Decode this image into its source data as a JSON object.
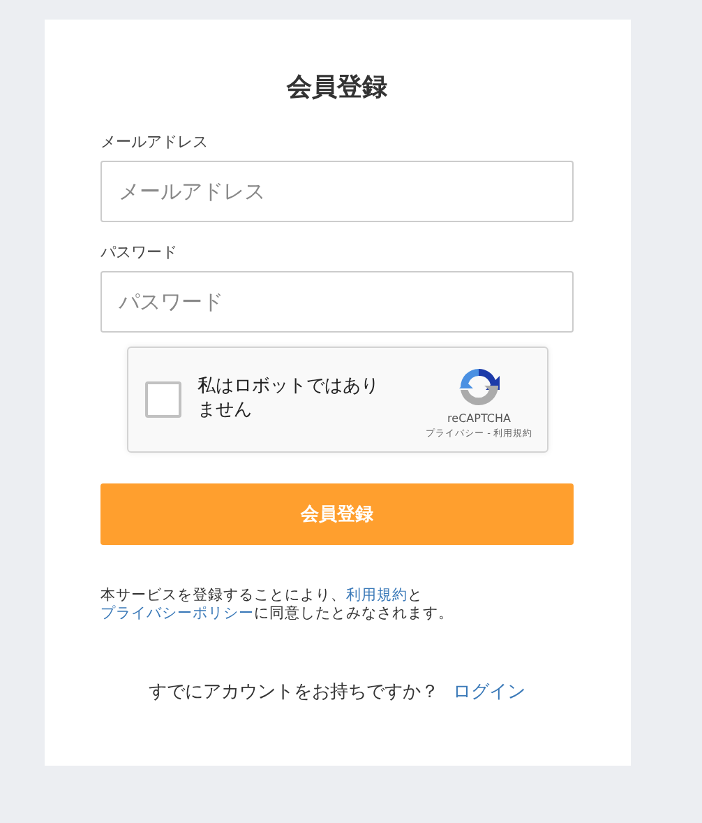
{
  "title": "会員登録",
  "fields": [
    {
      "label": "メールアドレス",
      "placeholder": "メールアドレス"
    },
    {
      "label": "パスワード",
      "placeholder": "パスワード"
    }
  ],
  "captcha": {
    "checked": false,
    "text": "私はロボットではありません",
    "brand": "reCAPTCHA",
    "links": "プライバシー - 利用規約"
  },
  "submit": "会員登録",
  "terms": {
    "before": "本サービスを登録することにより、",
    "link1": "利用規約",
    "middle": "と",
    "link2": "プライバシーポリシー",
    "after": "に同意したとみなされます。"
  },
  "login": {
    "question": "すでにアカウントをお持ちですか？",
    "link": "ログイン"
  }
}
